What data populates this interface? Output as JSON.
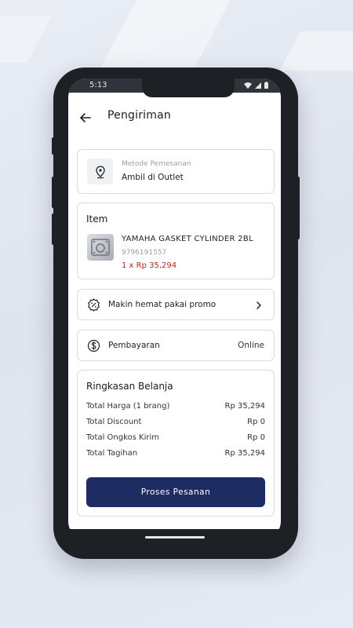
{
  "status_bar": {
    "time": "5:13"
  },
  "header": {
    "title": "Pengiriman"
  },
  "method": {
    "label": "Metode Pemesanan",
    "value": "Ambil di Outlet"
  },
  "item": {
    "section_title": "Item",
    "name": "YAMAHA GASKET CYLINDER 2BL",
    "code": "9796191557",
    "qty_price": "1 x Rp 35,294"
  },
  "promo": {
    "label": "Makin hemat pakai promo"
  },
  "payment": {
    "label": "Pembayaran",
    "value": "Online"
  },
  "summary": {
    "title": "Ringkasan Belanja",
    "rows": [
      {
        "label": "Total Harga (1 brang)",
        "value": "Rp 35,294"
      },
      {
        "label": "Total Discount",
        "value": "Rp 0"
      },
      {
        "label": "Total Ongkos Kirim",
        "value": "Rp 0"
      },
      {
        "label": "Total Tagihan",
        "value": "Rp 35,294"
      }
    ],
    "button": "Proses Pesanan"
  },
  "colors": {
    "primary": "#1d2d63",
    "price": "#b3261e"
  }
}
